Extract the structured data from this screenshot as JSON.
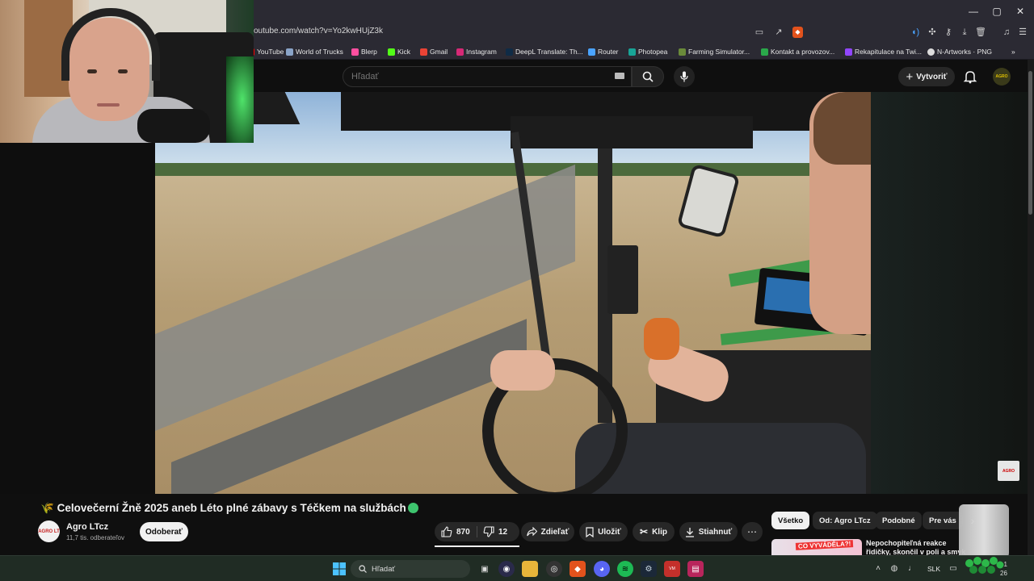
{
  "browser": {
    "url": "outube.com/watch?v=Yo2kwHUjZ3k",
    "window_controls": [
      "—",
      "▢",
      "✕"
    ],
    "bookmarks": [
      {
        "label": "YouTube",
        "color": "#ff0000"
      },
      {
        "label": "World of Trucks",
        "color": "#8aa4c8"
      },
      {
        "label": "Blerp",
        "color": "#ff4fa0"
      },
      {
        "label": "Kick",
        "color": "#53fc18"
      },
      {
        "label": "Gmail",
        "color": "#ea4335"
      },
      {
        "label": "Instagram",
        "color": "#d62976"
      },
      {
        "label": "DeepL Translate: Th...",
        "color": "#0f2b46"
      },
      {
        "label": "Router",
        "color": "#4aa3ff"
      },
      {
        "label": "Photopea",
        "color": "#18a497"
      },
      {
        "label": "Farming Simulator...",
        "color": "#6a8a3a"
      },
      {
        "label": "Kontakt a provozov...",
        "color": "#2aa84a"
      },
      {
        "label": "Rekapitulace na Twi...",
        "color": "#9146ff"
      },
      {
        "label": "N-Artworks · PNG",
        "color": "#dddddd"
      }
    ],
    "bookmarks_overflow": "»"
  },
  "youtube_header": {
    "search_placeholder": "Hľadať",
    "create_label": "Vytvoriť",
    "avatar_text": "AGRO"
  },
  "video": {
    "watermark": "AGRO"
  },
  "video_info": {
    "title": "Celovečerní Žně 2025 aneb Léto plné zábavy s Téčkem na službách",
    "channel_name": "Agro LTcz",
    "channel_avatar_text": "AGRO LT",
    "subscribers": "11,7 tis. odberateľov",
    "subscribe_label": "Odoberať",
    "likes": "870",
    "dislikes": "12",
    "share_label": "Zdieľať",
    "save_label": "Uložiť",
    "clip_label": "Klip",
    "download_label": "Stiahnuť",
    "more_label": "⋯"
  },
  "related": {
    "chips": [
      "Všetko",
      "Od: Agro LTcz",
      "Podobné",
      "Pre vás"
    ],
    "first_video": {
      "thumb_text": "CO VYVÁDĚLA?!",
      "title": "Nepochopiteľná reakce řidičky, skončil v poli a smyk na ledě"
    }
  },
  "taskbar": {
    "search_label": "Hľadať",
    "language": "SLK",
    "clock_line1": "1",
    "clock_line2": "26"
  },
  "colors": {
    "yt_bg": "#0f0f0f",
    "pill_bg": "#272727",
    "taskbar_bg": "#202c24",
    "accent_green": "#3ec46e"
  }
}
